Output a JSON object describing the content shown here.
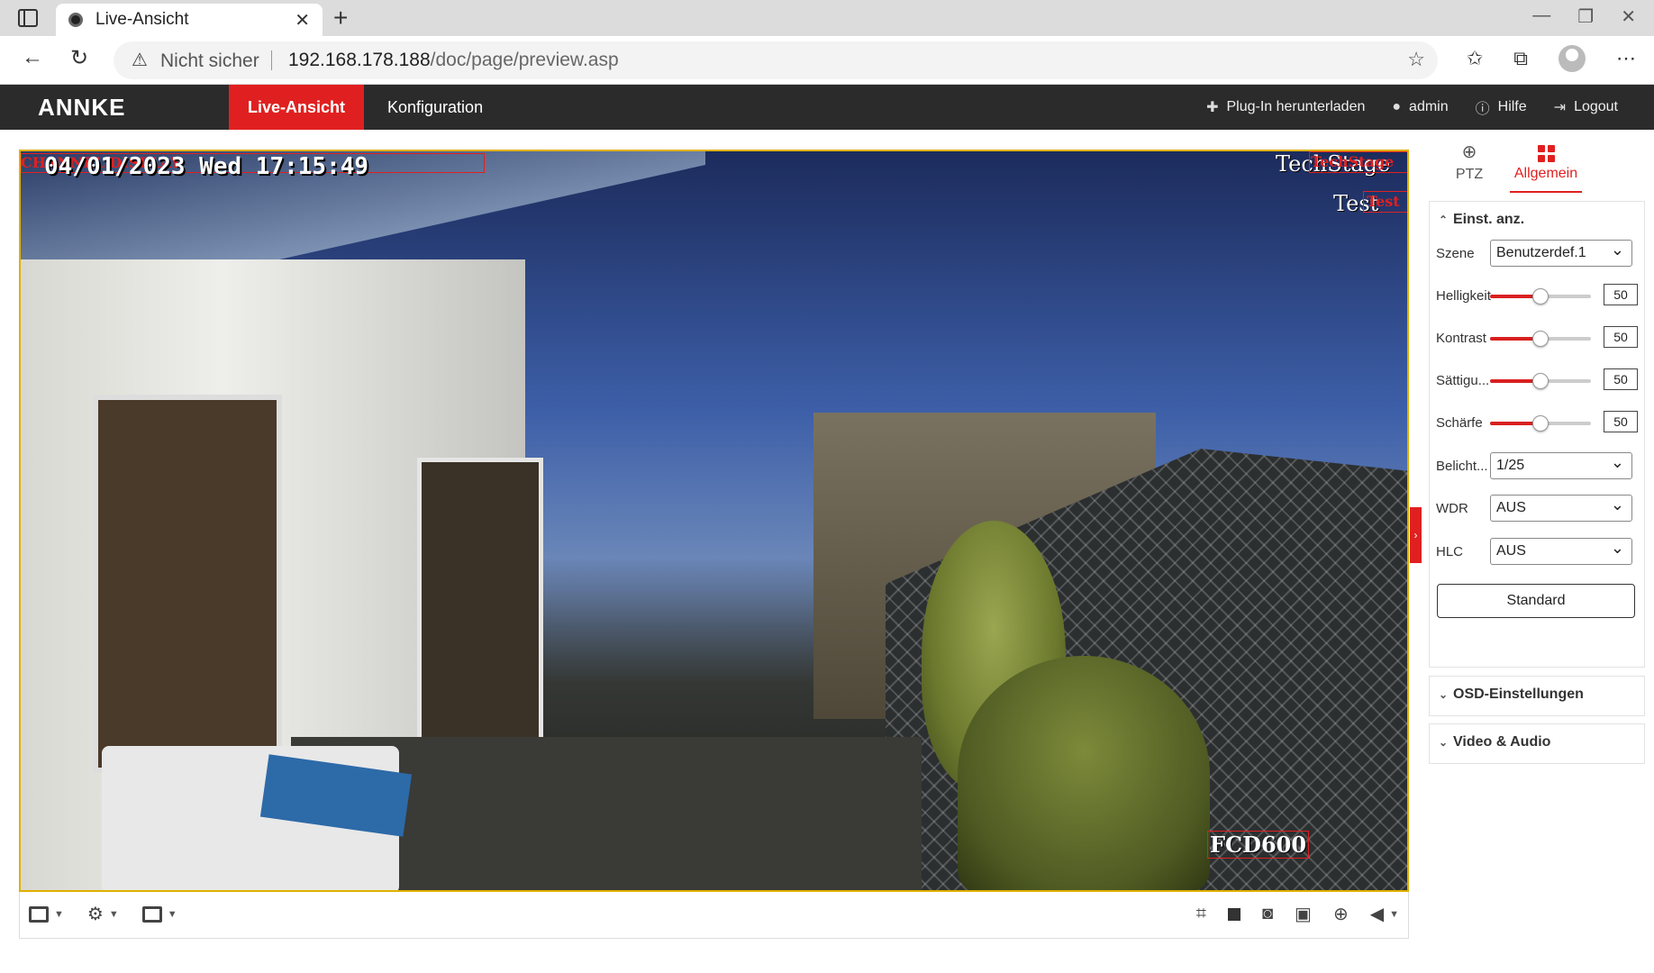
{
  "browser": {
    "tab_title": "Live-Ansicht",
    "tab_close": "✕",
    "new_tab": "+",
    "not_secure": "Nicht sicher",
    "url_host": "192.168.178.188",
    "url_path": "/doc/page/preview.asp",
    "icons": [
      "back-icon",
      "reload-icon",
      "warning-icon",
      "favorite-add-icon",
      "favorites-icon",
      "collections-icon",
      "profile-icon",
      "more-icon"
    ]
  },
  "header": {
    "logo": "ANNKE",
    "nav_live": "Live-Ansicht",
    "nav_config": "Konfiguration",
    "plugin": "Plug-In herunterladen",
    "user": "admin",
    "help": "Hilfe",
    "logout": "Logout"
  },
  "video": {
    "osd_date": "04/01/2023 Wed 17:15:49",
    "osd_top_left_red": "CHANNEL DISPLAY",
    "osd_techstage_white": "TechStage",
    "osd_techstage_red": "TechStage",
    "osd_test_white": "Test",
    "osd_test_red": "Test",
    "osd_camera": "FCD600"
  },
  "panel": {
    "tab_ptz": "PTZ",
    "tab_general": "Allgemein",
    "section_display": "Einst. anz.",
    "fields": {
      "scene_label": "Szene",
      "scene_value": "Benutzerdef.1",
      "brightness_label": "Helligkeit",
      "brightness_value": "50",
      "contrast_label": "Kontrast",
      "contrast_value": "50",
      "saturation_label": "Sättigu...",
      "saturation_value": "50",
      "sharpness_label": "Schärfe",
      "sharpness_value": "50",
      "exposure_label": "Belicht...",
      "exposure_value": "1/25",
      "wdr_label": "WDR",
      "wdr_value": "AUS",
      "hlc_label": "HLC",
      "hlc_value": "AUS"
    },
    "slider_fraction": 0.5,
    "standard_button": "Standard",
    "section_osd": "OSD-Einstellungen",
    "section_video_audio": "Video & Audio"
  },
  "colors": {
    "accent": "#e02020",
    "header_bg": "#2b2b2b",
    "video_border": "#e0b000"
  }
}
